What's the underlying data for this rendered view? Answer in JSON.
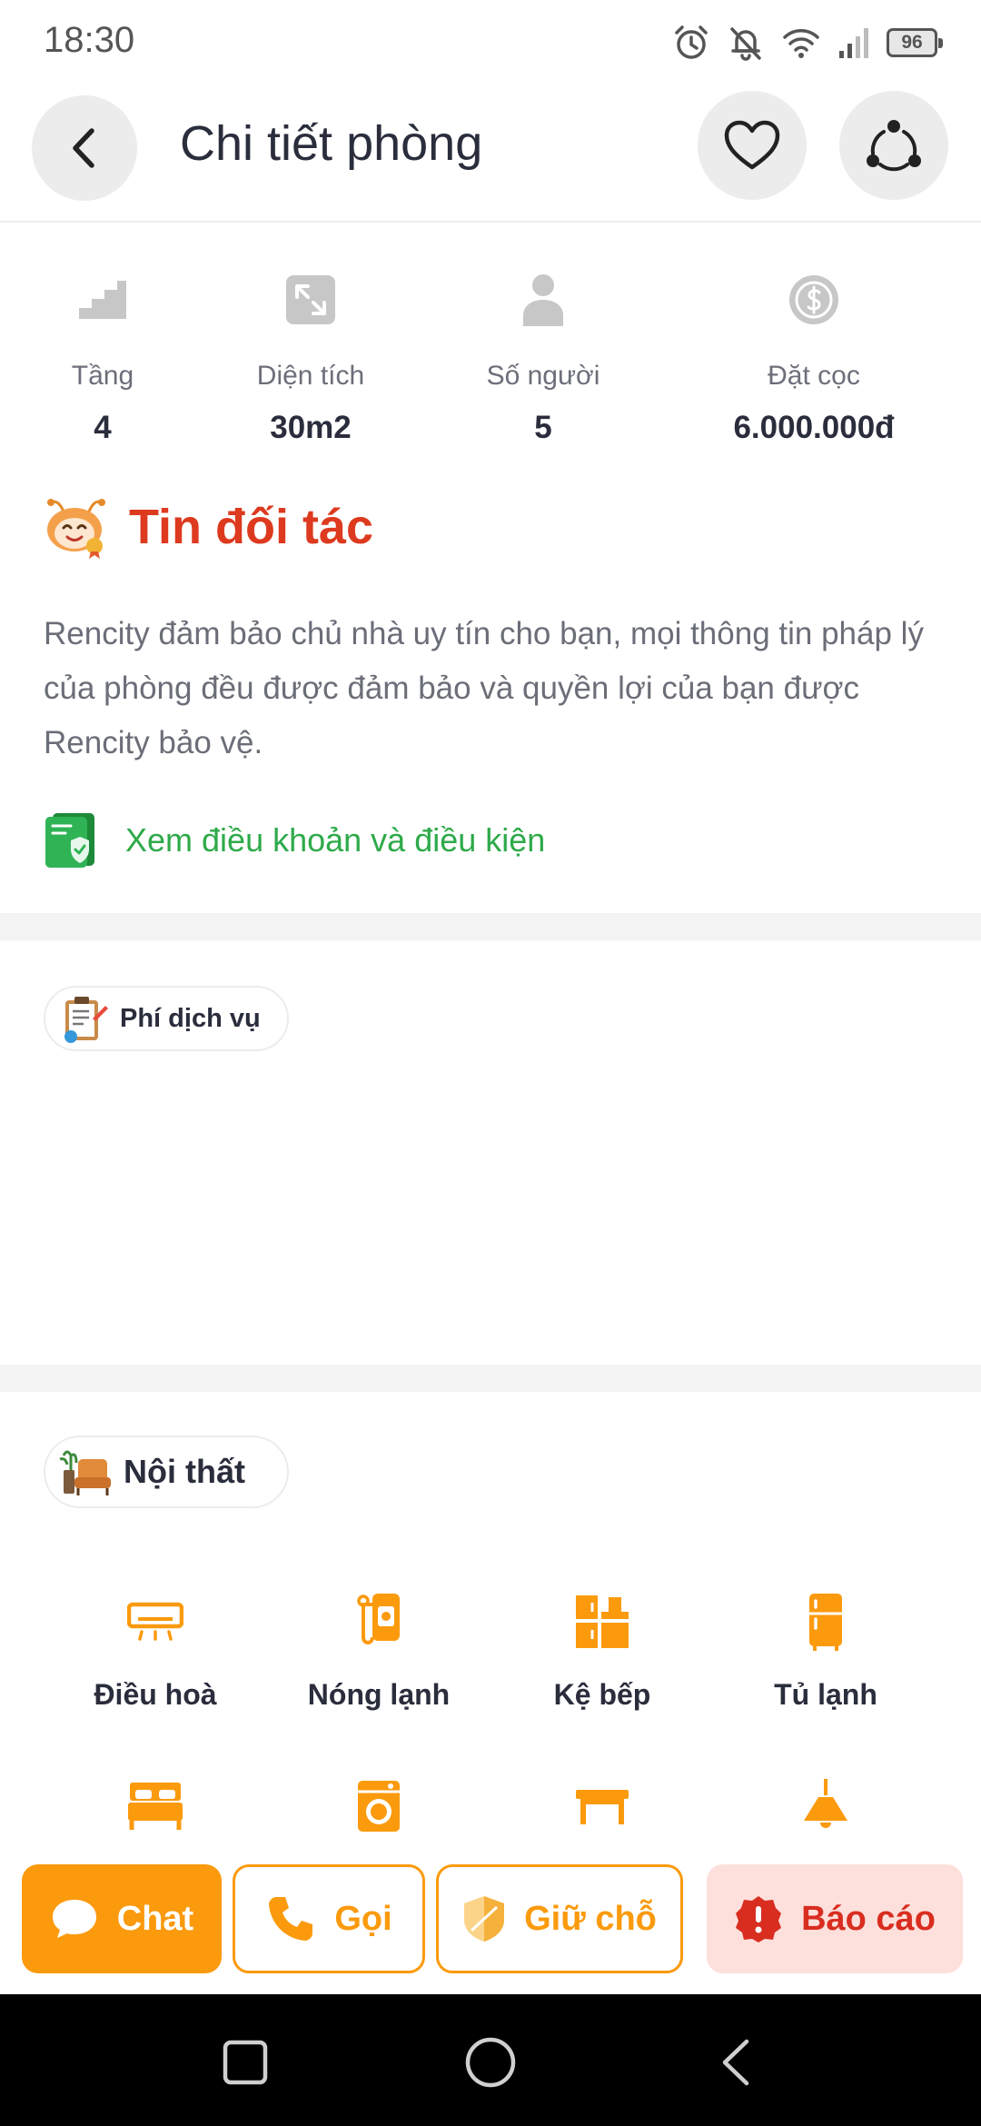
{
  "status_bar": {
    "time": "18:30",
    "battery": "96"
  },
  "header": {
    "title": "Chi tiết phòng"
  },
  "stats": [
    {
      "label": "Tầng",
      "value": "4",
      "icon": "stairs-icon"
    },
    {
      "label": "Diện tích",
      "value": "30m2",
      "icon": "expand-icon"
    },
    {
      "label": "Số người",
      "value": "5",
      "icon": "person-icon"
    },
    {
      "label": "Đặt cọc",
      "value": "6.000.000đ",
      "icon": "dollar-coin-icon"
    }
  ],
  "partner": {
    "title": "Tin đối tác",
    "description": "Rencity đảm bảo chủ nhà uy tín cho bạn, mọi thông tin pháp lý của phòng đều được đảm bảo và quyền lợi của bạn được Rencity bảo vệ.",
    "terms_link": "Xem điều khoản và điều kiện"
  },
  "service_fee": {
    "label": "Phí dịch vụ"
  },
  "furniture": {
    "label": "Nội thất",
    "items": [
      {
        "label": "Điều hoà",
        "icon": "air-conditioner-icon"
      },
      {
        "label": "Nóng lạnh",
        "icon": "water-heater-icon"
      },
      {
        "label": "Kệ bếp",
        "icon": "kitchen-shelf-icon"
      },
      {
        "label": "Tủ lạnh",
        "icon": "fridge-icon"
      },
      {
        "label": "",
        "icon": "bed-icon"
      },
      {
        "label": "",
        "icon": "washing-machine-icon"
      },
      {
        "label": "",
        "icon": "table-icon"
      },
      {
        "label": "",
        "icon": "lamp-icon"
      }
    ]
  },
  "actions": {
    "chat": "Chat",
    "call": "Gọi",
    "hold": "Giữ chỗ",
    "report": "Báo cáo"
  },
  "colors": {
    "accent": "#fb9a0d",
    "partner_red": "#dd3a1f",
    "link_green": "#2eaa4a",
    "report_bg": "#fde0dc",
    "report_text": "#d92d20"
  }
}
